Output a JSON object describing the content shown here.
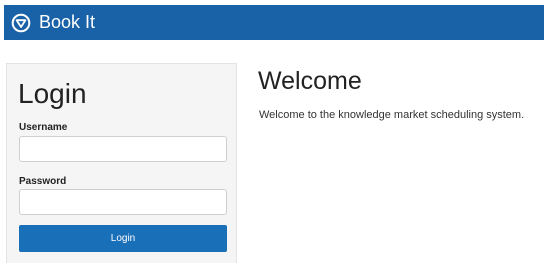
{
  "header": {
    "logo_icon": "chevron-down-circle-icon",
    "title": "Book It",
    "brand_color": "#1a62a8"
  },
  "login": {
    "heading": "Login",
    "username_label": "Username",
    "username_value": "",
    "password_label": "Password",
    "password_value": "",
    "submit_label": "Login",
    "button_color": "#1a6fb9"
  },
  "welcome": {
    "heading": "Welcome",
    "message": "Welcome to the knowledge market scheduling system."
  }
}
